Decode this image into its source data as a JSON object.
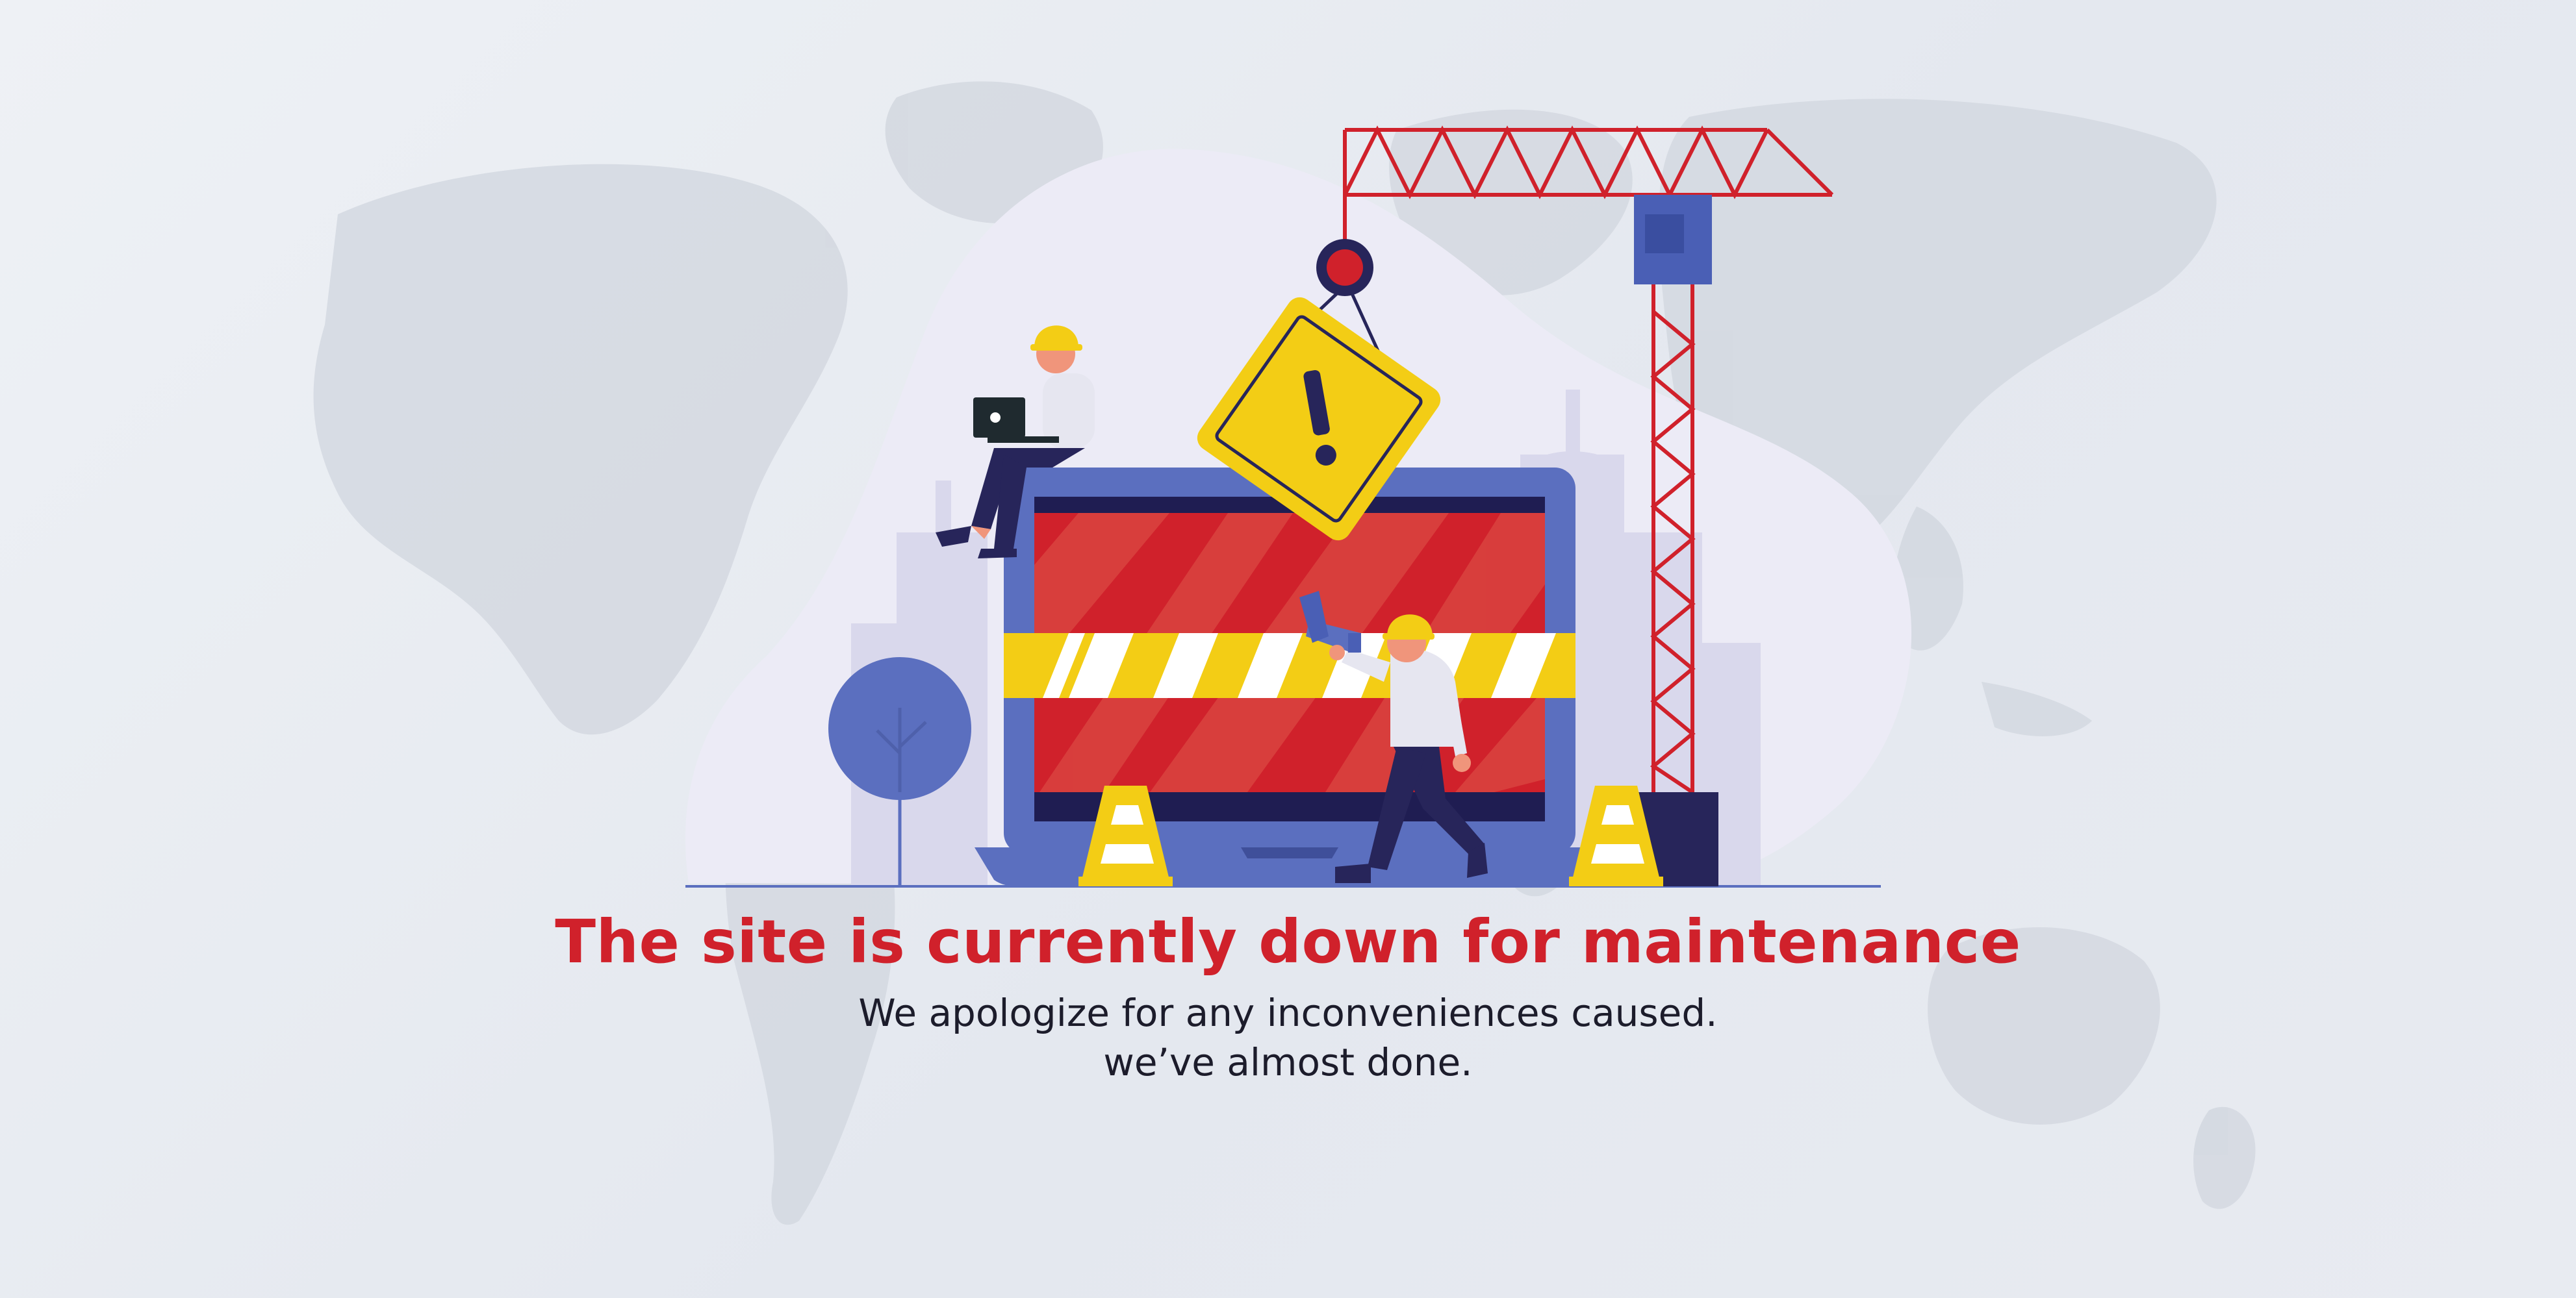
{
  "maintenance": {
    "headline": "The site is currently down for maintenance",
    "apology": "We apologize for any inconveniences caused.",
    "status": "we’ve almost done."
  },
  "illustration": {
    "icons": [
      "world-map-icon",
      "crane-icon",
      "warning-sign-icon",
      "laptop-icon",
      "worker-icon",
      "megaphone-icon",
      "traffic-cone-icon",
      "tree-icon",
      "barrier-tape-icon"
    ]
  },
  "colors": {
    "accent_red": "#d0212b",
    "laptop_blue": "#5b6fbf",
    "warning_yellow": "#f3cd15",
    "navy": "#27255a",
    "background": "#e8ebf1",
    "map_gray": "#d3d8e0",
    "blob": "#ecebf6"
  }
}
